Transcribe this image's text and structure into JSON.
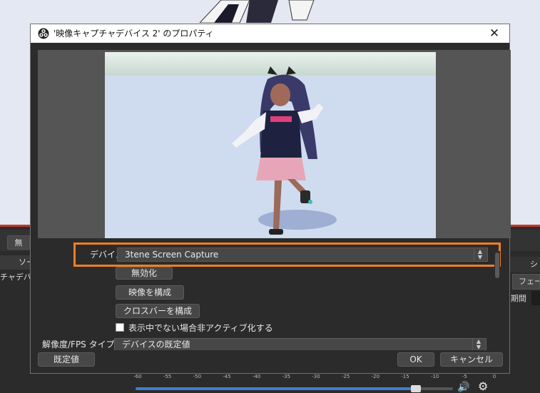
{
  "dialog": {
    "title": "'映像キャプチャデバイス 2' のプロパティ",
    "close_glyph": "✕"
  },
  "device": {
    "label": "デバイス",
    "value": "3tene Screen Capture"
  },
  "buttons": {
    "disable": "無効化",
    "configure_video": "映像を構成",
    "configure_crossbar": "クロスバーを構成"
  },
  "deactivate_checkbox": {
    "label": "表示中でない場合非アクティブ化する",
    "checked": false
  },
  "resolution": {
    "label": "解像度/FPS タイプ",
    "value": "デバイスの既定値"
  },
  "footer": {
    "defaults": "既定値",
    "ok": "OK",
    "cancel": "キャンセル"
  },
  "background": {
    "toolbar_button": "無",
    "sources_header": "ソー",
    "source_item": "チャデバイ",
    "transitions_header": "シー",
    "transition_select": "フェー",
    "duration_label": "期間",
    "mixer_scale": [
      "-60",
      "-55",
      "-50",
      "-45",
      "-40",
      "-35",
      "-30",
      "-25",
      "-20",
      "-15",
      "-10",
      "-5",
      "0"
    ],
    "mixer_level": 0.78
  },
  "icons": {
    "spin_up": "▲",
    "spin_down": "▼",
    "speaker": "🔊",
    "gear": "⚙"
  },
  "colors": {
    "highlight": "#f07f23",
    "dialog_bg": "#2b2b2b",
    "accent_red": "#c0392b",
    "mixer_blue": "#3d7fd1"
  }
}
